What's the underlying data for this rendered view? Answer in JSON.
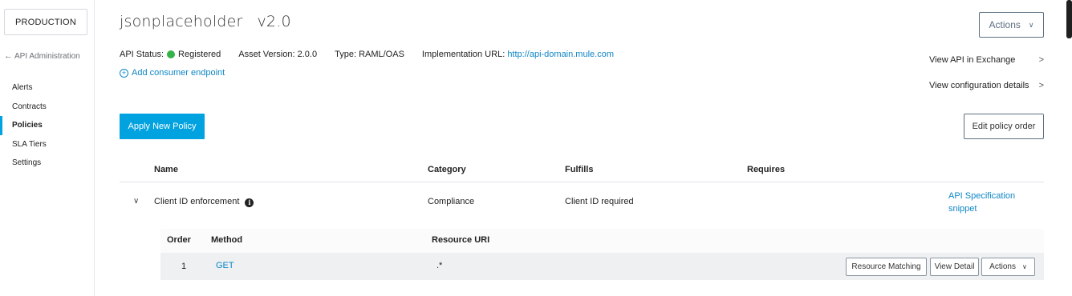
{
  "sidebar": {
    "environment_label": "PRODUCTION",
    "back_label": "API Administration",
    "items": [
      {
        "label": "Alerts",
        "active": false
      },
      {
        "label": "Contracts",
        "active": false
      },
      {
        "label": "Policies",
        "active": true
      },
      {
        "label": "SLA Tiers",
        "active": false
      },
      {
        "label": "Settings",
        "active": false
      }
    ]
  },
  "header": {
    "api_name": "jsonplaceholder",
    "version": "v2.0",
    "actions_label": "Actions",
    "status_label": "API Status:",
    "status_value": "Registered",
    "status_color": "#35b24a",
    "asset_version_label": "Asset Version:",
    "asset_version_value": "2.0.0",
    "type_label": "Type:",
    "type_value": "RAML/OAS",
    "impl_url_label": "Implementation URL:",
    "impl_url_value": "http://api-domain.mule.com",
    "add_consumer_endpoint": "Add consumer endpoint",
    "view_in_exchange": "View API in Exchange",
    "view_config_details": "View configuration details"
  },
  "toolbar": {
    "apply_policy_label": "Apply New Policy",
    "edit_order_label": "Edit policy order"
  },
  "policy_table": {
    "columns": [
      "Name",
      "Category",
      "Fulfills",
      "Requires"
    ],
    "rows": [
      {
        "name": "Client ID enforcement",
        "category": "Compliance",
        "fulfills": "Client ID required",
        "requires": "",
        "snippet_link": "API Specification snippet"
      }
    ]
  },
  "resource_table": {
    "columns": [
      "Order",
      "Method",
      "Resource URI"
    ],
    "rows": [
      {
        "order": "1",
        "method": "GET",
        "uri": ".*"
      }
    ],
    "buttons": {
      "resource_matching": "Resource Matching",
      "view_detail": "View Detail",
      "actions": "Actions"
    }
  },
  "colors": {
    "accent": "#00a2df",
    "link": "#0f86c6"
  }
}
